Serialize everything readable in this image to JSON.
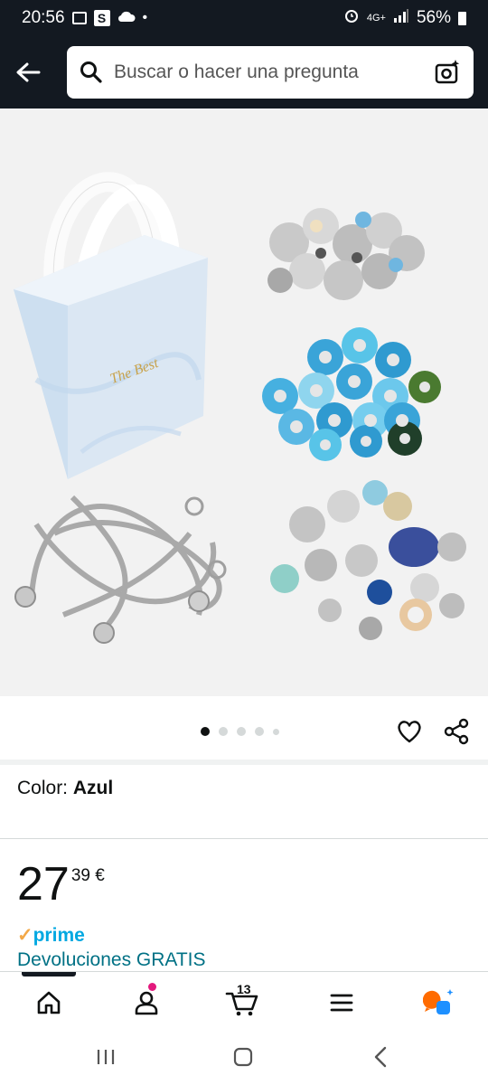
{
  "status_bar": {
    "time": "20:56",
    "network": "4G+",
    "battery": "56%"
  },
  "search": {
    "placeholder": "Buscar o hacer una pregunta"
  },
  "product": {
    "image_count": 5,
    "active_image_index": 0,
    "color_label": "Color:",
    "color_value": "Azul",
    "price_whole": "27",
    "price_fraction": "39 €",
    "prime_label": "prime",
    "returns_text": "Devoluciones GRATIS",
    "bag_logo_text": "The Best"
  },
  "bottom_nav": {
    "cart_count": "13",
    "items": [
      "home-icon",
      "account-icon",
      "cart-icon",
      "menu-icon",
      "rufus-icon"
    ]
  },
  "colors": {
    "header_bg": "#131921",
    "link": "#007185",
    "prime": "#00a8e1",
    "prime_check": "#f3a847",
    "notification": "#e3197d",
    "rufus_orange": "#ff6b00",
    "rufus_blue": "#1e90ff"
  }
}
